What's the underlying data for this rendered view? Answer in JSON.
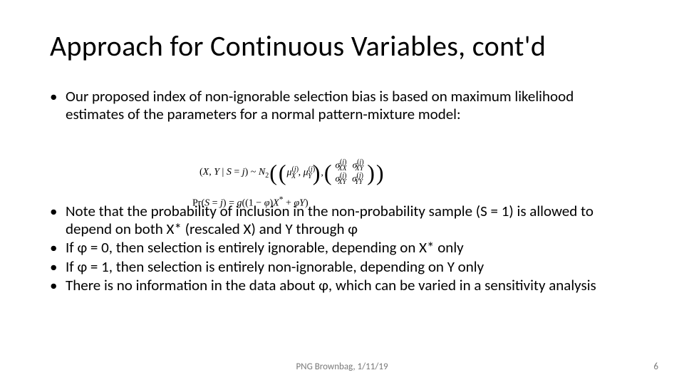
{
  "title": "Approach for Continuous Variables, cont'd",
  "bullets_top": [
    "Our proposed index of non-ignorable selection bias is based on maximum likelihood estimates of the parameters for a normal pattern-mixture model:"
  ],
  "bullets_bottom": [
    "Note that the probability of inclusion in the non-probability sample (S = 1) is allowed to depend on both X* (rescaled X) and Y through φ",
    "If φ = 0, then selection is entirely ignorable, depending on X* only",
    "If φ = 1, then selection is entirely non-ignorable, depending on Y only",
    "There is no information in the data about φ, which can be varied in a sensitivity analysis"
  ],
  "formula": {
    "dist": "(X, Y | S = j) ~ N₂",
    "means": [
      "μ_X^(j)",
      "μ_Y^(j)"
    ],
    "cov": [
      [
        "σ_XX^(j)",
        "σ_XY^(j)"
      ],
      [
        "σ_XY^(j)",
        "σ_YY^(j)"
      ]
    ],
    "prob": "Pr(S = j) = g((1 − φ)X* + φY)"
  },
  "footer": "PNG Brownbag, 1/11/19",
  "page_number": "6"
}
